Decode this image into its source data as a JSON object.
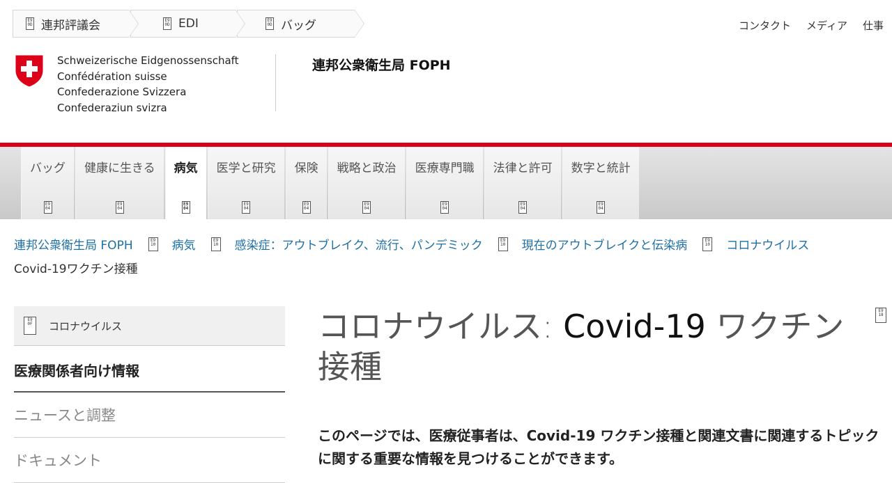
{
  "top_crumbs": [
    {
      "label": "連邦評議会",
      "icon": "glyph-0d-icon",
      "code": "E9\n0D"
    },
    {
      "label": "EDI",
      "icon": "glyph-0d-icon",
      "code": "E9\n0D"
    },
    {
      "label": "バッグ",
      "icon": "glyph-0d-icon",
      "code": "E9\n0D"
    }
  ],
  "top_links": [
    "コンタクト",
    "メディア",
    "仕事"
  ],
  "confederation_names": [
    "Schweizerische Eidgenossenschaft",
    "Confédération suisse",
    "Confederazione Svizzera",
    "Confederaziun svizra"
  ],
  "office_title": "連邦公衆衛生局 FOPH",
  "main_nav": [
    {
      "label": "バッグ",
      "code": "E9\n04"
    },
    {
      "label": "健康に生きる",
      "code": "E9\n04"
    },
    {
      "label": "病気",
      "code": "E9\n04",
      "active": true
    },
    {
      "label": "医学と研究",
      "code": "E9\n04"
    },
    {
      "label": "保険",
      "code": "E9\n04"
    },
    {
      "label": "戦略と政治",
      "code": "E9\n04"
    },
    {
      "label": "医療専門職",
      "code": "E9\n04"
    },
    {
      "label": "法律と許可",
      "code": "E9\n04"
    },
    {
      "label": "数字と統計",
      "code": "E9\n04"
    }
  ],
  "breadcrumb": {
    "separator_code": "E9\n10",
    "items": [
      "連邦公衆衛生局 FOPH",
      "病気",
      "感染症：アウトブレイク、流行、パンデミック",
      "現在のアウトブレイクと伝染病",
      "コロナウイルス"
    ],
    "current": "Covid-19ワクチン接種"
  },
  "sidebar": {
    "parent": {
      "label": "コロナウイルス",
      "code": "E9\n0F"
    },
    "active": "医療関係者向け情報",
    "items": [
      "ニュースと調整",
      "ドキュメント"
    ]
  },
  "content": {
    "title_part1": "コロナウイルス: ",
    "title_strong": "Covid-19",
    "title_part2": " ワクチン接種",
    "corner_code": "E9\n18",
    "lead": "このページでは、医療従事者は、Covid-19 ワクチン接種と関連文書に関連するトピックに関する重要な情報を見つけることができます。"
  },
  "colors": {
    "brand_red": "#dc0018",
    "link_blue": "#1d6fa6"
  }
}
